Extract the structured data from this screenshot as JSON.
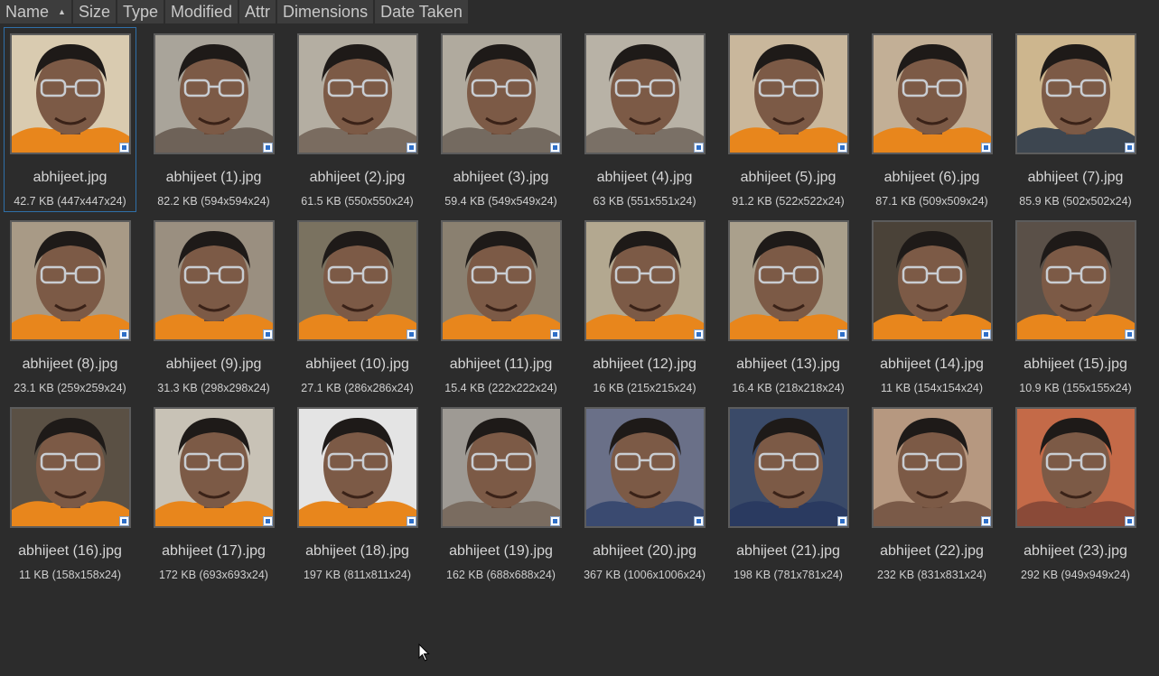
{
  "columns": [
    {
      "label": "Name",
      "sort_indicator": "▲"
    },
    {
      "label": "Size"
    },
    {
      "label": "Type"
    },
    {
      "label": "Modified"
    },
    {
      "label": "Attr"
    },
    {
      "label": "Dimensions"
    },
    {
      "label": "Date Taken"
    }
  ],
  "files": [
    {
      "name": "abhijeet.jpg",
      "info": "42.7 KB (447x447x24)",
      "selected": true,
      "bg": "#d9cbb0",
      "shirt": "#e8861c",
      "icon": "image-file-badge-icon"
    },
    {
      "name": "abhijeet (1).jpg",
      "info": "82.2 KB (594x594x24)",
      "bg": "#a9a49a",
      "shirt": "#6e6258",
      "icon": "image-file-badge-icon"
    },
    {
      "name": "abhijeet (2).jpg",
      "info": "61.5 KB (550x550x24)",
      "bg": "#b4aea2",
      "shirt": "#7a6c60",
      "icon": "image-file-badge-icon"
    },
    {
      "name": "abhijeet (3).jpg",
      "info": "59.4 KB (549x549x24)",
      "bg": "#b0aa9e",
      "shirt": "#746a60",
      "icon": "image-file-badge-icon"
    },
    {
      "name": "abhijeet (4).jpg",
      "info": "63 KB (551x551x24)",
      "bg": "#b8b2a6",
      "shirt": "#7a7066",
      "icon": "image-file-badge-icon"
    },
    {
      "name": "abhijeet (5).jpg",
      "info": "91.2 KB (522x522x24)",
      "bg": "#c9b79c",
      "shirt": "#e8861c",
      "icon": "image-file-badge-icon"
    },
    {
      "name": "abhijeet (6).jpg",
      "info": "87.1 KB (509x509x24)",
      "bg": "#c2af96",
      "shirt": "#e8861c",
      "icon": "image-file-badge-icon"
    },
    {
      "name": "abhijeet (7).jpg",
      "info": "85.9 KB (502x502x24)",
      "bg": "#cdb68e",
      "shirt": "#3d4650",
      "icon": "image-file-badge-icon"
    },
    {
      "name": "abhijeet (8).jpg",
      "info": "23.1 KB (259x259x24)",
      "bg": "#a89a86",
      "shirt": "#e8861c",
      "icon": "image-file-badge-icon"
    },
    {
      "name": "abhijeet (9).jpg",
      "info": "31.3 KB (298x298x24)",
      "bg": "#9a8f80",
      "shirt": "#e8861c",
      "icon": "image-file-badge-icon"
    },
    {
      "name": "abhijeet (10).jpg",
      "info": "27.1 KB (286x286x24)",
      "bg": "#7a7260",
      "shirt": "#e8861c",
      "icon": "image-file-badge-icon"
    },
    {
      "name": "abhijeet (11).jpg",
      "info": "15.4 KB (222x222x24)",
      "bg": "#8a8070",
      "shirt": "#e8861c",
      "icon": "image-file-badge-icon"
    },
    {
      "name": "abhijeet (12).jpg",
      "info": "16 KB (215x215x24)",
      "bg": "#b3a890",
      "shirt": "#e8861c",
      "icon": "image-file-badge-icon"
    },
    {
      "name": "abhijeet (13).jpg",
      "info": "16.4 KB (218x218x24)",
      "bg": "#aaa08c",
      "shirt": "#e8861c",
      "icon": "image-file-badge-icon"
    },
    {
      "name": "abhijeet (14).jpg",
      "info": "11 KB (154x154x24)",
      "bg": "#4a4238",
      "shirt": "#e8861c",
      "icon": "image-file-badge-icon"
    },
    {
      "name": "abhijeet (15).jpg",
      "info": "10.9 KB (155x155x24)",
      "bg": "#5a5048",
      "shirt": "#e8861c",
      "icon": "image-file-badge-icon"
    },
    {
      "name": "abhijeet (16).jpg",
      "info": "11 KB (158x158x24)",
      "bg": "#5a5044",
      "shirt": "#e8861c",
      "icon": "image-file-badge-icon"
    },
    {
      "name": "abhijeet (17).jpg",
      "info": "172 KB (693x693x24)",
      "bg": "#c8c2b6",
      "shirt": "#e8861c",
      "icon": "image-file-badge-icon"
    },
    {
      "name": "abhijeet (18).jpg",
      "info": "197 KB (811x811x24)",
      "bg": "#e4e4e4",
      "shirt": "#e8861c",
      "icon": "image-file-badge-icon"
    },
    {
      "name": "abhijeet (19).jpg",
      "info": "162 KB (688x688x24)",
      "bg": "#9e9a94",
      "shirt": "#7a6c60",
      "icon": "image-file-badge-icon"
    },
    {
      "name": "abhijeet (20).jpg",
      "info": "367 KB (1006x1006x24)",
      "bg": "#6a7088",
      "shirt": "#3a4a70",
      "icon": "image-file-badge-icon"
    },
    {
      "name": "abhijeet (21).jpg",
      "info": "198 KB (781x781x24)",
      "bg": "#3a4a68",
      "shirt": "#2a3a60",
      "icon": "image-file-badge-icon"
    },
    {
      "name": "abhijeet (22).jpg",
      "info": "232 KB (831x831x24)",
      "bg": "#b69880",
      "shirt": "#7a5a48",
      "icon": "image-file-badge-icon"
    },
    {
      "name": "abhijeet (23).jpg",
      "info": "292 KB (949x949x24)",
      "bg": "#c46a48",
      "shirt": "#8a4a38",
      "icon": "image-file-badge-icon"
    }
  ],
  "colors": {
    "background": "#2c2c2c",
    "header_bg": "#3d3d3d",
    "text": "#d6d6d6",
    "selection_border": "#2f6fa8"
  },
  "cursor_icon": "mouse-pointer-icon"
}
